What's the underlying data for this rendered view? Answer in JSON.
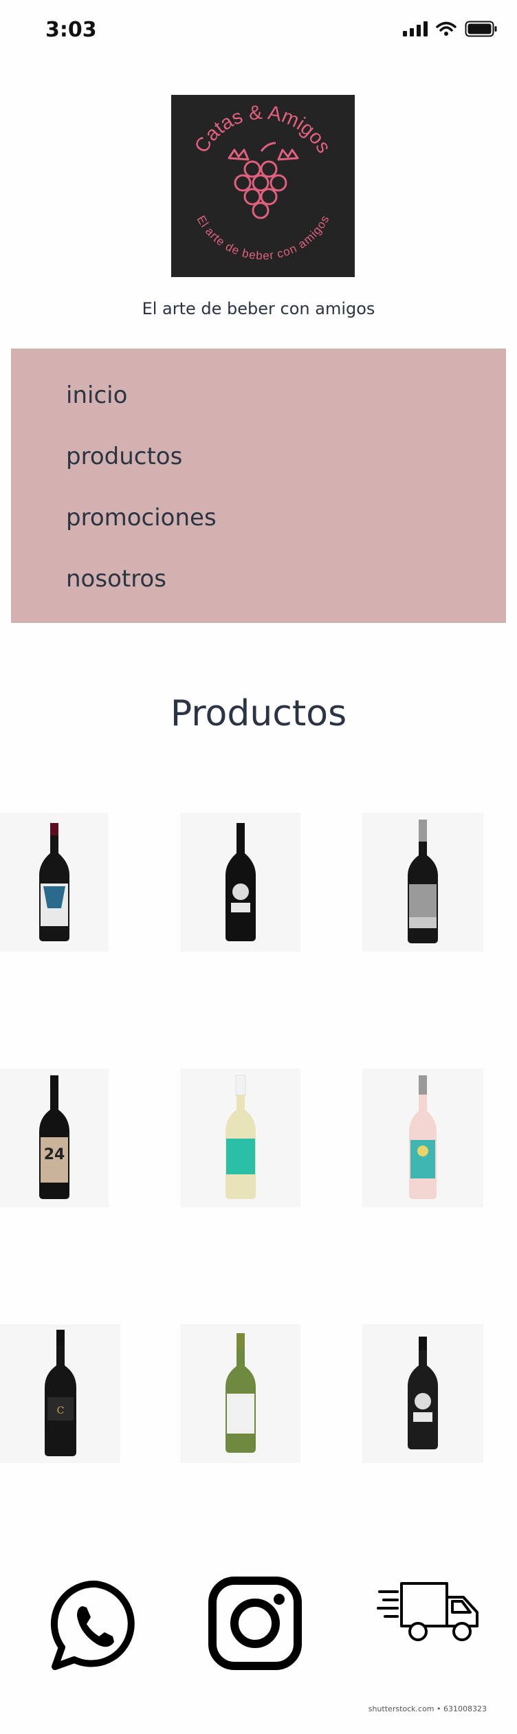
{
  "status_bar": {
    "time": "3:03",
    "icons": [
      "signal-icon",
      "wifi-icon",
      "battery-icon"
    ]
  },
  "logo": {
    "top_text": "Catas & Amigos",
    "bottom_text": "El arte de beber con amigos",
    "colors": {
      "background": "#242424",
      "accent": "#e0607e"
    }
  },
  "tagline": "El arte de beber con amigos",
  "nav": {
    "background": "#d4b1b1",
    "items": [
      {
        "label": "inicio"
      },
      {
        "label": "productos"
      },
      {
        "label": "promociones"
      },
      {
        "label": "nosotros"
      }
    ]
  },
  "products": {
    "title": "Productos",
    "items": [
      {
        "icon": "wine-bottle-icon",
        "bottle": "dark",
        "label_color": "#e9e9e9"
      },
      {
        "icon": "wine-bottle-icon",
        "bottle": "dark",
        "label_color": "#1a1a1a"
      },
      {
        "icon": "wine-bottle-icon",
        "bottle": "dark",
        "label_color": "#9a9a9a"
      },
      {
        "icon": "wine-bottle-icon",
        "bottle": "dark",
        "label_color": "#c9b39a"
      },
      {
        "icon": "wine-bottle-icon",
        "bottle": "white-wine",
        "label_color": "#2bbfa7"
      },
      {
        "icon": "wine-bottle-icon",
        "bottle": "rose",
        "label_color": "#3fb6b0"
      },
      {
        "icon": "wine-bottle-icon",
        "bottle": "dark",
        "label_color": "#2a2a2a"
      },
      {
        "icon": "wine-bottle-icon",
        "bottle": "green",
        "label_color": "#f1f1f1"
      },
      {
        "icon": "wine-bottle-icon",
        "bottle": "dark",
        "label_color": "#1c1c1c"
      }
    ]
  },
  "footer": {
    "icons": [
      "whatsapp-icon",
      "instagram-icon",
      "delivery-truck-icon"
    ],
    "credit": "shutterstock.com • 631008323"
  }
}
